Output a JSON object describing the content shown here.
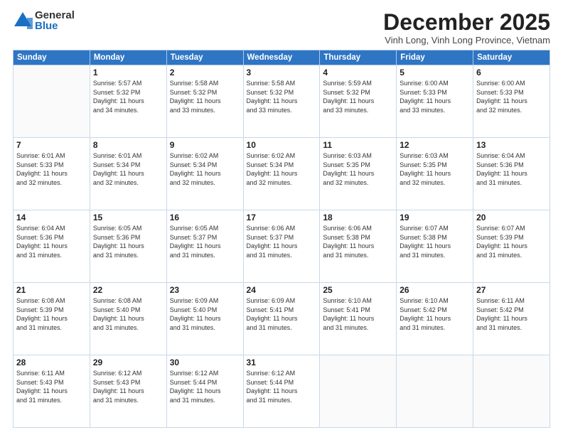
{
  "logo": {
    "general": "General",
    "blue": "Blue"
  },
  "title": "December 2025",
  "subtitle": "Vinh Long, Vinh Long Province, Vietnam",
  "weekdays": [
    "Sunday",
    "Monday",
    "Tuesday",
    "Wednesday",
    "Thursday",
    "Friday",
    "Saturday"
  ],
  "weeks": [
    [
      {
        "day": "",
        "info": ""
      },
      {
        "day": "1",
        "info": "Sunrise: 5:57 AM\nSunset: 5:32 PM\nDaylight: 11 hours\nand 34 minutes."
      },
      {
        "day": "2",
        "info": "Sunrise: 5:58 AM\nSunset: 5:32 PM\nDaylight: 11 hours\nand 33 minutes."
      },
      {
        "day": "3",
        "info": "Sunrise: 5:58 AM\nSunset: 5:32 PM\nDaylight: 11 hours\nand 33 minutes."
      },
      {
        "day": "4",
        "info": "Sunrise: 5:59 AM\nSunset: 5:32 PM\nDaylight: 11 hours\nand 33 minutes."
      },
      {
        "day": "5",
        "info": "Sunrise: 6:00 AM\nSunset: 5:33 PM\nDaylight: 11 hours\nand 33 minutes."
      },
      {
        "day": "6",
        "info": "Sunrise: 6:00 AM\nSunset: 5:33 PM\nDaylight: 11 hours\nand 32 minutes."
      }
    ],
    [
      {
        "day": "7",
        "info": "Sunrise: 6:01 AM\nSunset: 5:33 PM\nDaylight: 11 hours\nand 32 minutes."
      },
      {
        "day": "8",
        "info": "Sunrise: 6:01 AM\nSunset: 5:34 PM\nDaylight: 11 hours\nand 32 minutes."
      },
      {
        "day": "9",
        "info": "Sunrise: 6:02 AM\nSunset: 5:34 PM\nDaylight: 11 hours\nand 32 minutes."
      },
      {
        "day": "10",
        "info": "Sunrise: 6:02 AM\nSunset: 5:34 PM\nDaylight: 11 hours\nand 32 minutes."
      },
      {
        "day": "11",
        "info": "Sunrise: 6:03 AM\nSunset: 5:35 PM\nDaylight: 11 hours\nand 32 minutes."
      },
      {
        "day": "12",
        "info": "Sunrise: 6:03 AM\nSunset: 5:35 PM\nDaylight: 11 hours\nand 32 minutes."
      },
      {
        "day": "13",
        "info": "Sunrise: 6:04 AM\nSunset: 5:36 PM\nDaylight: 11 hours\nand 31 minutes."
      }
    ],
    [
      {
        "day": "14",
        "info": "Sunrise: 6:04 AM\nSunset: 5:36 PM\nDaylight: 11 hours\nand 31 minutes."
      },
      {
        "day": "15",
        "info": "Sunrise: 6:05 AM\nSunset: 5:36 PM\nDaylight: 11 hours\nand 31 minutes."
      },
      {
        "day": "16",
        "info": "Sunrise: 6:05 AM\nSunset: 5:37 PM\nDaylight: 11 hours\nand 31 minutes."
      },
      {
        "day": "17",
        "info": "Sunrise: 6:06 AM\nSunset: 5:37 PM\nDaylight: 11 hours\nand 31 minutes."
      },
      {
        "day": "18",
        "info": "Sunrise: 6:06 AM\nSunset: 5:38 PM\nDaylight: 11 hours\nand 31 minutes."
      },
      {
        "day": "19",
        "info": "Sunrise: 6:07 AM\nSunset: 5:38 PM\nDaylight: 11 hours\nand 31 minutes."
      },
      {
        "day": "20",
        "info": "Sunrise: 6:07 AM\nSunset: 5:39 PM\nDaylight: 11 hours\nand 31 minutes."
      }
    ],
    [
      {
        "day": "21",
        "info": "Sunrise: 6:08 AM\nSunset: 5:39 PM\nDaylight: 11 hours\nand 31 minutes."
      },
      {
        "day": "22",
        "info": "Sunrise: 6:08 AM\nSunset: 5:40 PM\nDaylight: 11 hours\nand 31 minutes."
      },
      {
        "day": "23",
        "info": "Sunrise: 6:09 AM\nSunset: 5:40 PM\nDaylight: 11 hours\nand 31 minutes."
      },
      {
        "day": "24",
        "info": "Sunrise: 6:09 AM\nSunset: 5:41 PM\nDaylight: 11 hours\nand 31 minutes."
      },
      {
        "day": "25",
        "info": "Sunrise: 6:10 AM\nSunset: 5:41 PM\nDaylight: 11 hours\nand 31 minutes."
      },
      {
        "day": "26",
        "info": "Sunrise: 6:10 AM\nSunset: 5:42 PM\nDaylight: 11 hours\nand 31 minutes."
      },
      {
        "day": "27",
        "info": "Sunrise: 6:11 AM\nSunset: 5:42 PM\nDaylight: 11 hours\nand 31 minutes."
      }
    ],
    [
      {
        "day": "28",
        "info": "Sunrise: 6:11 AM\nSunset: 5:43 PM\nDaylight: 11 hours\nand 31 minutes."
      },
      {
        "day": "29",
        "info": "Sunrise: 6:12 AM\nSunset: 5:43 PM\nDaylight: 11 hours\nand 31 minutes."
      },
      {
        "day": "30",
        "info": "Sunrise: 6:12 AM\nSunset: 5:44 PM\nDaylight: 11 hours\nand 31 minutes."
      },
      {
        "day": "31",
        "info": "Sunrise: 6:12 AM\nSunset: 5:44 PM\nDaylight: 11 hours\nand 31 minutes."
      },
      {
        "day": "",
        "info": ""
      },
      {
        "day": "",
        "info": ""
      },
      {
        "day": "",
        "info": ""
      }
    ]
  ]
}
